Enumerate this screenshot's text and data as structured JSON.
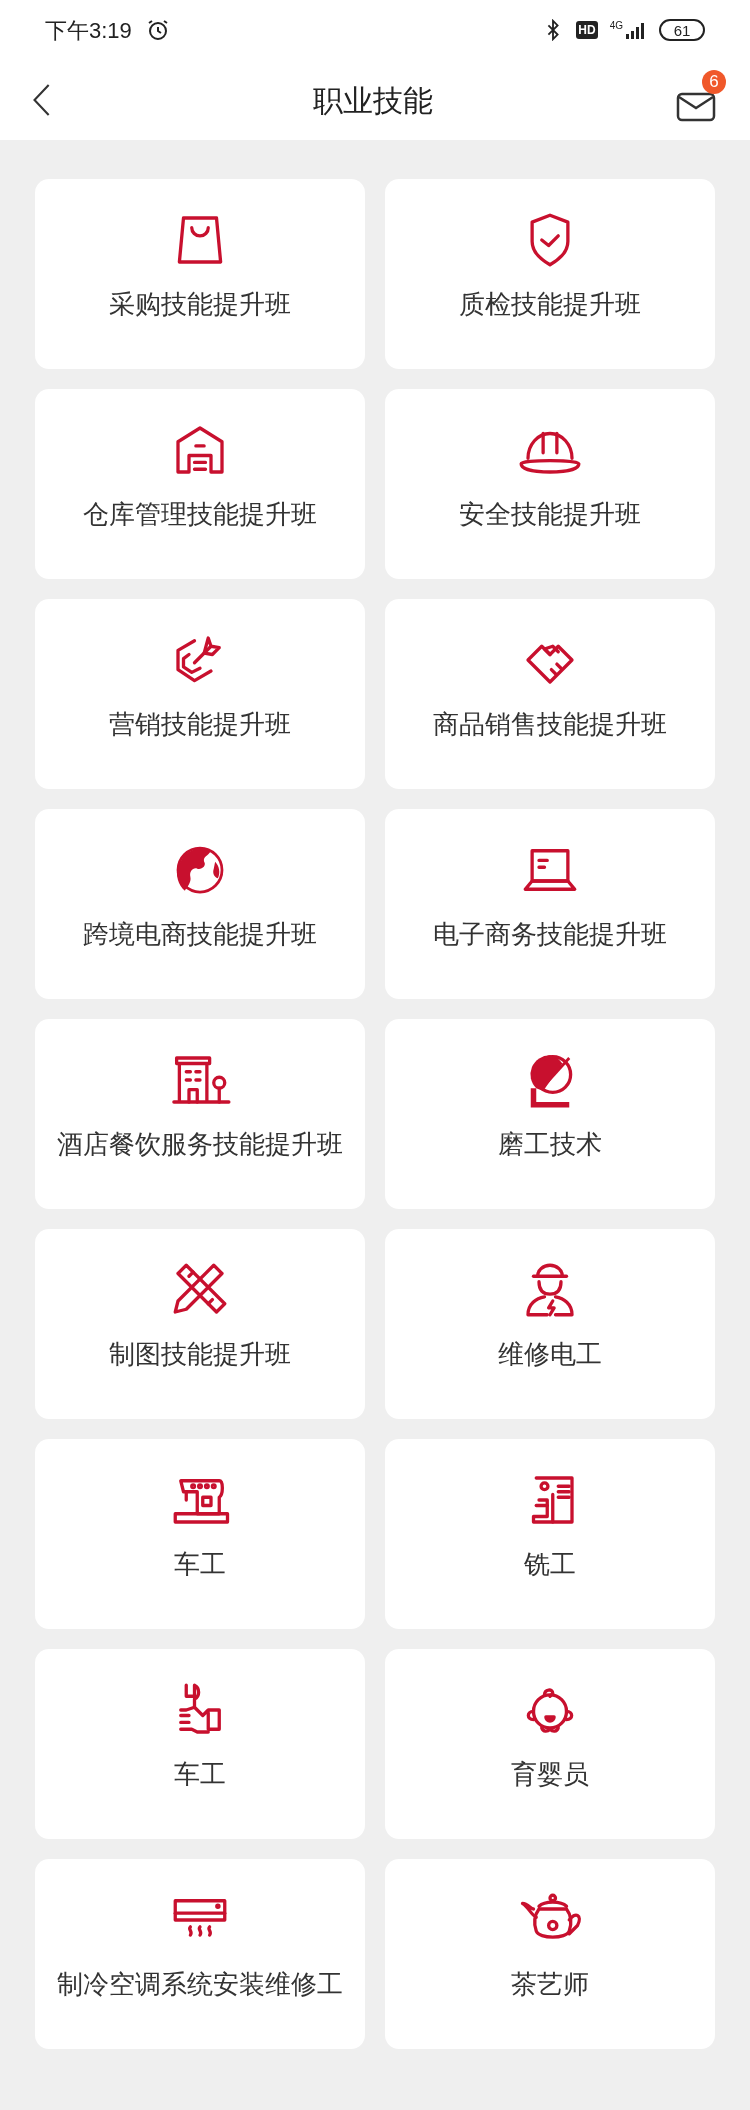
{
  "status_bar": {
    "time": "下午3:19",
    "hd": "HD",
    "network": "4G",
    "battery": "61"
  },
  "header": {
    "title": "职业技能",
    "mail_badge": "6"
  },
  "courses": [
    {
      "label": "采购技能提升班"
    },
    {
      "label": "质检技能提升班"
    },
    {
      "label": "仓库管理技能提升班"
    },
    {
      "label": "安全技能提升班"
    },
    {
      "label": "营销技能提升班"
    },
    {
      "label": "商品销售技能提升班"
    },
    {
      "label": "跨境电商技能提升班"
    },
    {
      "label": "电子商务技能提升班"
    },
    {
      "label": "酒店餐饮服务技能提升班"
    },
    {
      "label": "磨工技术"
    },
    {
      "label": "制图技能提升班"
    },
    {
      "label": "维修电工"
    },
    {
      "label": "车工"
    },
    {
      "label": "铣工"
    },
    {
      "label": "车工"
    },
    {
      "label": "育婴员"
    },
    {
      "label": "制冷空调系统安装维修工"
    },
    {
      "label": "茶艺师"
    }
  ]
}
